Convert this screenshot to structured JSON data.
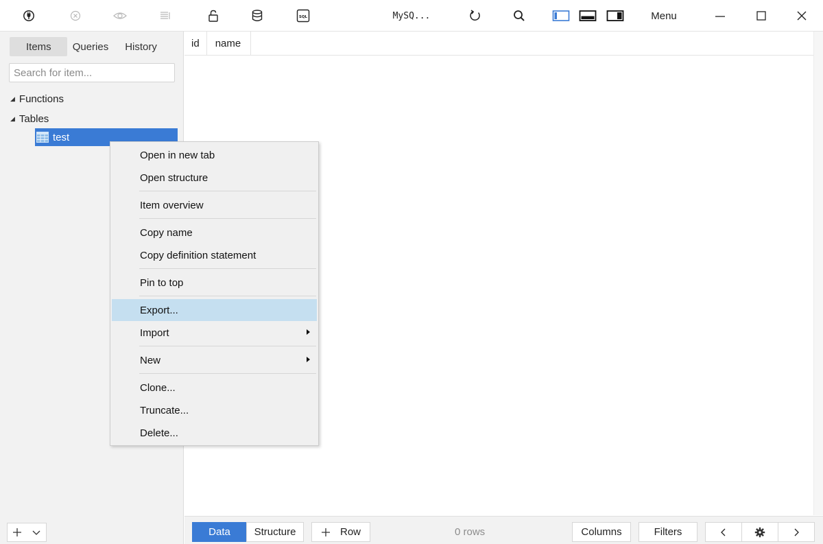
{
  "toolbar": {
    "connection_label": "MySQ...",
    "menu_label": "Menu",
    "icons": [
      "plug-icon",
      "close-circle-icon",
      "eye-icon",
      "list-icon",
      "lock-icon",
      "database-icon",
      "sql-icon",
      "refresh-icon",
      "search-icon",
      "layout-left-icon",
      "layout-bottom-icon",
      "layout-right-icon",
      "minimize-icon",
      "maximize-icon",
      "close-icon"
    ]
  },
  "sidebar": {
    "tabs": [
      {
        "label": "Items",
        "active": true
      },
      {
        "label": "Queries",
        "active": false
      },
      {
        "label": "History",
        "active": false
      }
    ],
    "search": {
      "placeholder": "Search for item...",
      "value": ""
    },
    "tree": {
      "groups": [
        {
          "label": "Functions",
          "expanded": true
        },
        {
          "label": "Tables",
          "expanded": true
        }
      ],
      "selected_item": {
        "label": "test",
        "icon": "table-icon"
      }
    },
    "bottom": {
      "add_symbol": "+",
      "dropdown_symbol": "v"
    }
  },
  "grid": {
    "columns": [
      "id",
      "name"
    ]
  },
  "bottom_bar": {
    "data_label": "Data",
    "structure_label": "Structure",
    "row_button": {
      "plus": "+",
      "label": "Row"
    },
    "rows_count": "0 rows",
    "columns_label": "Columns",
    "filters_label": "Filters"
  },
  "context_menu": {
    "items": [
      {
        "label": "Open in new tab"
      },
      {
        "label": "Open structure"
      },
      {
        "label": "Item overview"
      },
      {
        "label": "Copy name"
      },
      {
        "label": "Copy definition statement"
      },
      {
        "label": "Pin to top"
      },
      {
        "label": "Export...",
        "highlighted": true
      },
      {
        "label": "Import",
        "submenu": true
      },
      {
        "label": "New",
        "submenu": true
      },
      {
        "label": "Clone..."
      },
      {
        "label": "Truncate..."
      },
      {
        "label": "Delete..."
      }
    ]
  },
  "colors": {
    "accent": "#3a7bd5",
    "menu_highlight": "#c5dff0",
    "sidebar_bg": "#f2f2f2",
    "menu_bg": "#f0f0f0"
  }
}
